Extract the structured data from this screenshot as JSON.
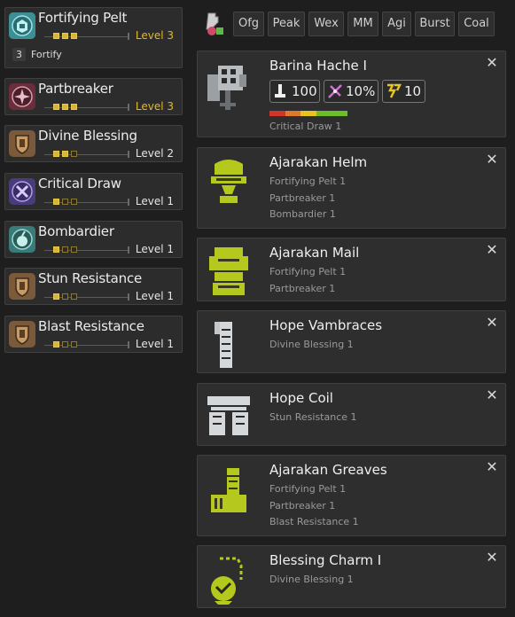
{
  "skills": [
    {
      "name": "Fortifying Pelt",
      "pips": [
        true,
        true,
        true
      ],
      "level": "Level 3",
      "max": true,
      "bonus_num": "3",
      "bonus_name": "Fortify"
    },
    {
      "name": "Partbreaker",
      "pips": [
        true,
        true,
        true
      ],
      "level": "Level 3",
      "max": true
    },
    {
      "name": "Divine Blessing",
      "pips": [
        true,
        true,
        false
      ],
      "level": "Level 2",
      "max": false
    },
    {
      "name": "Critical Draw",
      "pips": [
        true,
        false,
        false
      ],
      "level": "Level 1",
      "max": false
    },
    {
      "name": "Bombardier",
      "pips": [
        true,
        false,
        false
      ],
      "level": "Level 1",
      "max": false
    },
    {
      "name": "Stun Resistance",
      "pips": [
        true,
        false,
        false
      ],
      "level": "Level 1",
      "max": false
    },
    {
      "name": "Blast Resistance",
      "pips": [
        true,
        false,
        false
      ],
      "level": "Level 1",
      "max": false
    }
  ],
  "filters": [
    "Ofg",
    "Peak",
    "Wex",
    "MM",
    "Agi",
    "Burst",
    "Coal"
  ],
  "weapon": {
    "name": "Barina Hache I",
    "attack": "100",
    "affinity": "10%",
    "element": "10",
    "skill": "Critical Draw 1",
    "sharpness": [
      {
        "color": "#d0342c",
        "fraction": 0.2
      },
      {
        "color": "#e07a2a",
        "fraction": 0.2
      },
      {
        "color": "#e6c51e",
        "fraction": 0.2
      },
      {
        "color": "#6cbf28",
        "fraction": 0.4
      }
    ]
  },
  "armor": [
    {
      "name": "Ajarakan Helm",
      "skills": [
        "Fortifying Pelt 1",
        "Partbreaker 1",
        "Bombardier 1"
      ]
    },
    {
      "name": "Ajarakan Mail",
      "skills": [
        "Fortifying Pelt 1",
        "Partbreaker 1"
      ]
    },
    {
      "name": "Hope Vambraces",
      "skills": [
        "Divine Blessing 1"
      ]
    },
    {
      "name": "Hope Coil",
      "skills": [
        "Stun Resistance 1"
      ]
    },
    {
      "name": "Ajarakan Greaves",
      "skills": [
        "Fortifying Pelt 1",
        "Partbreaker 1",
        "Blast Resistance 1"
      ]
    },
    {
      "name": "Blessing Charm I",
      "skills": [
        "Divine Blessing 1"
      ]
    }
  ],
  "close_glyph": "✕",
  "colors": {
    "max_level": "#e8b91e",
    "pip_on": "#d7b53a",
    "armor_green": "#b5c81e"
  },
  "icons": {
    "skills": [
      "fortifying-pelt-icon",
      "partbreaker-icon",
      "divine-blessing-icon",
      "critical-draw-icon",
      "bombardier-icon",
      "stun-resistance-icon",
      "blast-resistance-icon"
    ],
    "weapon": "great-sword-icon",
    "armor": [
      "helm-icon",
      "chest-icon",
      "arms-icon",
      "waist-icon",
      "legs-icon",
      "charm-icon"
    ]
  }
}
